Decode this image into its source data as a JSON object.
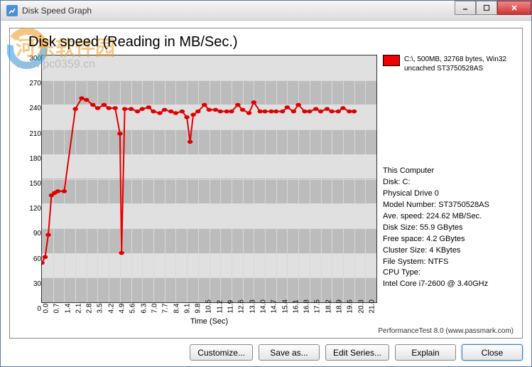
{
  "window": {
    "title": "Disk Speed Graph"
  },
  "watermark": {
    "line1": "河东软件园",
    "line2": "www.pc0359.cn"
  },
  "chart_title": "Disk speed (Reading in MB/Sec.)",
  "legend": {
    "color": "#e00000",
    "text": "C:\\, 500MB, 32768 bytes, Win32 uncached ST3750528AS"
  },
  "info": {
    "header": "This Computer",
    "disk": "Disk: C:",
    "physical": "Physical Drive 0",
    "model": "Model Number: ST3750528AS",
    "avg": "Ave. speed: 224.62 MB/Sec.",
    "size": "Disk Size: 55.9 GBytes",
    "free": "Free space: 4.2 GBytes",
    "cluster": "Cluster Size: 4 KBytes",
    "fs": "File System: NTFS",
    "cpu_label": "CPU Type:",
    "cpu": "Intel Core i7-2600 @ 3.40GHz"
  },
  "xlabel": "Time (Sec)",
  "footer": "PerformanceTest 8.0 (www.passmark.com)",
  "buttons": {
    "customize": "Customize...",
    "saveas": "Save as...",
    "editseries": "Edit Series...",
    "explain": "Explain",
    "close": "Close"
  },
  "chart_data": {
    "type": "line",
    "title": "Disk speed (Reading in MB/Sec.)",
    "xlabel": "Time (Sec)",
    "ylabel": "",
    "ylim": [
      0,
      300
    ],
    "xlim": [
      0.0,
      21.0
    ],
    "yticks": [
      0,
      30,
      60,
      90,
      120,
      150,
      180,
      210,
      240,
      270,
      300
    ],
    "xticks": [
      0.0,
      0.7,
      1.4,
      2.1,
      2.8,
      3.5,
      4.2,
      4.9,
      5.6,
      6.3,
      7.0,
      7.7,
      8.4,
      9.1,
      9.8,
      10.5,
      11.2,
      11.9,
      12.6,
      13.3,
      14.0,
      14.7,
      15.4,
      16.1,
      16.8,
      17.5,
      18.2,
      18.9,
      19.6,
      20.3,
      21.0
    ],
    "series": [
      {
        "name": "C:\\, 500MB, 32768 bytes, Win32 uncached ST3750528AS",
        "color": "#e00000",
        "x": [
          0.0,
          0.2,
          0.4,
          0.6,
          0.8,
          1.0,
          1.4,
          2.1,
          2.5,
          2.8,
          3.2,
          3.5,
          3.9,
          4.2,
          4.6,
          4.9,
          5.0,
          5.2,
          5.6,
          6.0,
          6.3,
          6.7,
          7.0,
          7.4,
          7.7,
          8.1,
          8.4,
          8.8,
          9.1,
          9.3,
          9.5,
          9.8,
          10.2,
          10.5,
          10.9,
          11.2,
          11.6,
          11.9,
          12.3,
          12.6,
          13.0,
          13.3,
          13.7,
          14.0,
          14.4,
          14.7,
          15.1,
          15.4,
          15.8,
          16.1,
          16.5,
          16.8,
          17.2,
          17.5,
          17.9,
          18.2,
          18.6,
          18.9,
          19.3,
          19.6
        ],
        "values": [
          48,
          55,
          82,
          130,
          133,
          135,
          135,
          235,
          248,
          246,
          240,
          236,
          240,
          236,
          236,
          205,
          60,
          235,
          235,
          232,
          235,
          237,
          232,
          230,
          234,
          232,
          230,
          232,
          225,
          195,
          228,
          232,
          240,
          234,
          234,
          232,
          232,
          232,
          240,
          234,
          230,
          243,
          232,
          232,
          232,
          232,
          232,
          237,
          232,
          240,
          232,
          232,
          235,
          232,
          235,
          232,
          232,
          236,
          232,
          232
        ]
      }
    ]
  }
}
